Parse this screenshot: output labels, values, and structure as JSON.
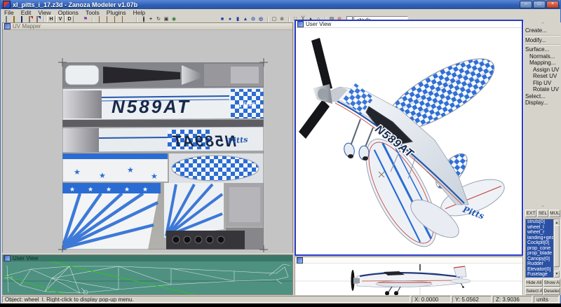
{
  "window": {
    "title": "xl_pitts_i_17.z3d - Zanoza Modeler v1.07b",
    "minimize": "–",
    "maximize": "□",
    "close": "×"
  },
  "menu": {
    "items": [
      "File",
      "Edit",
      "View",
      "Options",
      "Tools",
      "Plugins",
      "Help"
    ]
  },
  "toolbar": {
    "h": "H",
    "v": "V",
    "d": "D",
    "texture_selector": "<Null>"
  },
  "viewports": {
    "uv_mapper": {
      "title": "UV Mapper"
    },
    "user_view": {
      "title": "User View"
    },
    "over_view": {
      "title": "User View"
    },
    "side_view": {
      "title": ""
    }
  },
  "texture": {
    "registration": "N589AT",
    "logo": "Pitts"
  },
  "model": {
    "registration": "N589AT",
    "logo": "Pitts"
  },
  "right_panel": {
    "menu": [
      "Create...",
      "Modify...",
      "Surface...",
      "Normals...",
      "Mapping...",
      "Assign UV",
      "Reset UV",
      "Flip UV",
      "Rotate UV",
      "Select...",
      "Display..."
    ],
    "modes": [
      "EXT",
      "SEL",
      "MUL"
    ],
    "objects": [
      "struts[0]",
      "wheel_l",
      "wheel_r",
      "landing+gear",
      "Cockpit[0]",
      "prop_cone",
      "prop_blade",
      "Canopy[0]",
      "Rudder",
      "Elevator[0]",
      "Fuselage"
    ],
    "list_buttons": [
      "Hide All",
      "Show All",
      "Select All",
      "Deselect"
    ]
  },
  "status": {
    "message": "Object: wheel_l. Right-click to display pop-up menu.",
    "x": "X: 0.0000",
    "y": "Y: 5.0562",
    "z": "Z: 3.9036",
    "units": "units"
  },
  "colors": {
    "titlebar": "#2f62b8",
    "accent_blue": "#2a6cd4",
    "stripe_blue": "#2458b0",
    "panel": "#d6d3ca",
    "teal_viewport": "#4e9181",
    "selection": "#2a51a5",
    "prop_black": "#15161a",
    "red_trim": "#c0392b"
  }
}
